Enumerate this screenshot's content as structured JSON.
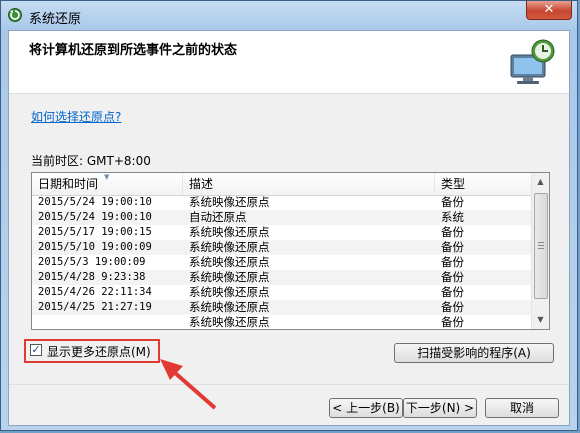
{
  "window": {
    "title": "系统还原",
    "close_label": "✕"
  },
  "header": {
    "heading": "将计算机还原到所选事件之前的状态"
  },
  "help_link": "如何选择还原点?",
  "timezone": "当前时区: GMT+8:00",
  "columns": {
    "datetime": "日期和时间",
    "description": "描述",
    "type": "类型"
  },
  "rows": [
    {
      "datetime": "2015/5/24 19:00:10",
      "description": "系统映像还原点",
      "type": "备份"
    },
    {
      "datetime": "2015/5/24 19:00:10",
      "description": "自动还原点",
      "type": "系统"
    },
    {
      "datetime": "2015/5/17 19:00:15",
      "description": "系统映像还原点",
      "type": "备份"
    },
    {
      "datetime": "2015/5/10 19:00:09",
      "description": "系统映像还原点",
      "type": "备份"
    },
    {
      "datetime": "2015/5/3 19:00:09",
      "description": "系统映像还原点",
      "type": "备份"
    },
    {
      "datetime": "2015/4/28 9:23:38",
      "description": "系统映像还原点",
      "type": "备份"
    },
    {
      "datetime": "2015/4/26 22:11:34",
      "description": "系统映像还原点",
      "type": "备份"
    },
    {
      "datetime": "2015/4/25 21:27:19",
      "description": "系统映像还原点",
      "type": "备份"
    },
    {
      "datetime": "",
      "description": "系统映像还原点",
      "type": "备份"
    }
  ],
  "show_more": {
    "label": "显示更多还原点(M)",
    "checked": true
  },
  "buttons": {
    "scan": "扫描受影响的程序(A)",
    "back": "< 上一步(B)",
    "next": "下一步(N) >",
    "cancel": "取消"
  },
  "colors": {
    "annotation": "#e23a33",
    "link": "#0066cc"
  }
}
